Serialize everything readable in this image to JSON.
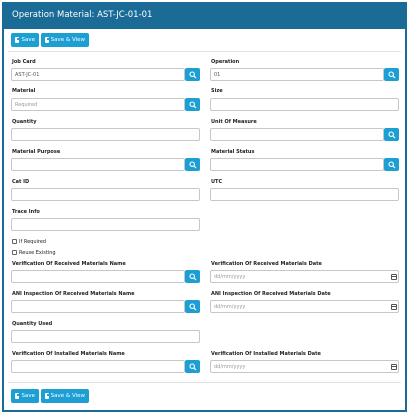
{
  "header": {
    "title": "Operation Material: AST-JC-01-01"
  },
  "toolbar": {
    "save_label": "Save",
    "save_view_label": "Save & View"
  },
  "fields": {
    "job_card": {
      "label": "Job Card",
      "value": "AST-JC-01"
    },
    "operation": {
      "label": "Operation",
      "value": "01"
    },
    "material": {
      "label": "Material",
      "placeholder": "Required"
    },
    "size": {
      "label": "Size",
      "value": ""
    },
    "quantity": {
      "label": "Quantity",
      "value": ""
    },
    "unit_of_measure": {
      "label": "Unit Of Measure",
      "value": ""
    },
    "material_purpose": {
      "label": "Material Purpose",
      "value": ""
    },
    "material_status": {
      "label": "Material Status",
      "value": ""
    },
    "cat_id": {
      "label": "Cat ID",
      "value": ""
    },
    "utc": {
      "label": "UTC",
      "value": ""
    },
    "trace_info": {
      "label": "Trace Info",
      "value": ""
    },
    "if_required": {
      "label": "If Required",
      "checked": false
    },
    "reuse_existing": {
      "label": "Reuse Existing",
      "checked": false
    },
    "verif_received_name": {
      "label": "Verification Of Received Materials Name",
      "value": ""
    },
    "verif_received_date": {
      "label": "Verification Of Received Materials Date",
      "placeholder": "dd/mm/yyyy"
    },
    "ani_received_name": {
      "label": "ANI Inspection Of Received Materials Name",
      "value": ""
    },
    "ani_received_date": {
      "label": "ANI Inspection Of Received Materials Date",
      "placeholder": "dd/mm/yyyy"
    },
    "quantity_used": {
      "label": "Quantity Used",
      "value": ""
    },
    "verif_installed_name": {
      "label": "Verification Of Installed Materials Name",
      "value": ""
    },
    "verif_installed_date": {
      "label": "Verification Of Installed Materials Date",
      "placeholder": "dd/mm/yyyy"
    }
  },
  "icons": {
    "search": "search-icon",
    "calendar": "calendar-icon",
    "save": "floppy-disk-icon"
  },
  "colors": {
    "header": "#1a6b96",
    "button": "#1d9fd3"
  }
}
